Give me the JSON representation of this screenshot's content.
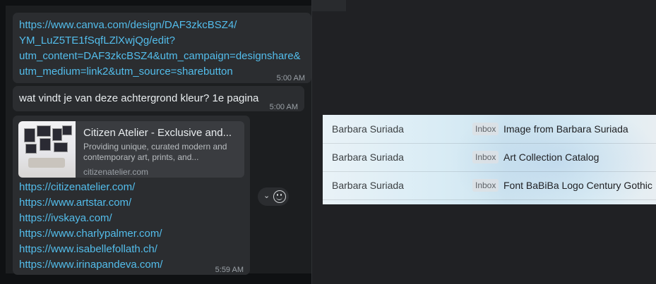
{
  "chat": {
    "messages": [
      {
        "lines": [
          "https://www.canva.com/design/DAF3zkcBSZ4/",
          "YM_LuZ5TE1fSqfLZlXwjQg/edit?",
          "utm_content=DAF3zkcBSZ4&utm_campaign=designshare&",
          "utm_medium=link2&utm_source=sharebutton"
        ],
        "time": "5:00 AM"
      },
      {
        "text": "wat vindt je van deze achtergrond kleur? 1e pagina",
        "time": "5:00 AM"
      },
      {
        "preview": {
          "title": "Citizen Atelier - Exclusive and...",
          "description": "Providing unique, curated modern and contemporary art, prints, and...",
          "site": "citizenatelier.com"
        },
        "lines": [
          "https://citizenatelier.com/",
          "https://www.artstar.com/",
          "https://ivskaya.com/",
          "https://www.charlypalmer.com/",
          "https://www.isabellefollath.ch/",
          "https://www.irinapandeva.com/"
        ],
        "time": "5:59 AM"
      }
    ],
    "reaction_icons": [
      "chevron-down-icon",
      "emoji-icon"
    ]
  },
  "mail": {
    "rows": [
      {
        "sender": "Barbara Suriada",
        "label": "Inbox",
        "subject": "Image from Barbara Suriada"
      },
      {
        "sender": "Barbara Suriada",
        "label": "Inbox",
        "subject": "Art Collection Catalog"
      },
      {
        "sender": "Barbara Suriada",
        "label": "Inbox",
        "subject": "Font BaBiBa Logo Century Gothic"
      }
    ]
  },
  "colors": {
    "link": "#53bdeb",
    "bubble": "#2b2d30",
    "chat_bg": "#1c1e20"
  }
}
